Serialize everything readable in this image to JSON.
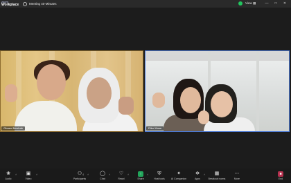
{
  "titlebar": {
    "brand_line1": "zoom",
    "brand_line2": "Workplace",
    "meeting_title": "Meeting 40-Minutes",
    "view_label": "View",
    "controls": [
      "—",
      "□",
      "✕"
    ]
  },
  "participants": [
    {
      "name": "Ghazal Meshab"
    },
    {
      "name": "Riko Wose"
    }
  ],
  "toolbar": {
    "items": [
      {
        "label": "Audio",
        "icon": "microphone-icon"
      },
      {
        "label": "Video",
        "icon": "video-camera-icon"
      },
      {
        "label": "Participants",
        "icon": "participants-icon",
        "count": "4"
      },
      {
        "label": "Chat",
        "icon": "chat-icon"
      },
      {
        "label": "React",
        "icon": "heart-icon"
      },
      {
        "label": "Share",
        "icon": "share-screen-icon"
      },
      {
        "label": "Host tools",
        "icon": "shield-icon"
      },
      {
        "label": "AI Companion",
        "icon": "sparkle-icon"
      },
      {
        "label": "Apps",
        "icon": "apps-icon"
      },
      {
        "label": "Breakout rooms",
        "icon": "grid-icon"
      },
      {
        "label": "More",
        "icon": "more-icon"
      },
      {
        "label": "End",
        "icon": "end-icon"
      }
    ]
  },
  "colors": {
    "secure": "#22c55e",
    "share": "#22a55b",
    "end": "#b5304e",
    "active_speaker_border": "#4c7ad6"
  }
}
